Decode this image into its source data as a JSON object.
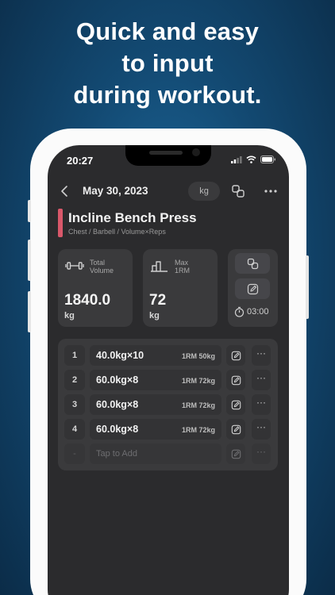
{
  "headline": [
    "Quick and easy",
    "to input",
    "during workout."
  ],
  "status": {
    "time": "20:27"
  },
  "nav": {
    "date": "May 30, 2023",
    "unit": "kg"
  },
  "exercise": {
    "title": "Incline Bench Press",
    "subtitle": "Chest / Barbell / Volume×Reps",
    "accent": "#d9586a"
  },
  "cards": {
    "volume": {
      "label_line1": "Total",
      "label_line2": "Volume",
      "value": "1840.0",
      "unit": "kg"
    },
    "max": {
      "label_line1": "Max",
      "label_line2": "1RM",
      "value": "72",
      "unit": "kg"
    },
    "timer": {
      "value": "03:00"
    }
  },
  "sets": [
    {
      "num": "1",
      "weight_reps": "40.0kg×10",
      "one_rm": "1RM 50kg"
    },
    {
      "num": "2",
      "weight_reps": "60.0kg×8",
      "one_rm": "1RM 72kg"
    },
    {
      "num": "3",
      "weight_reps": "60.0kg×8",
      "one_rm": "1RM 72kg"
    },
    {
      "num": "4",
      "weight_reps": "60.0kg×8",
      "one_rm": "1RM 72kg"
    }
  ],
  "add_row": {
    "num": "-",
    "placeholder": "Tap to Add"
  },
  "icons": {
    "back": "chevron-left-icon",
    "swap": "swap-icon",
    "more": "more-icon",
    "dumbbell": "dumbbell-icon",
    "chart": "bar-chart-icon",
    "copy": "copy-icon",
    "edit": "edit-icon",
    "timer": "stopwatch-icon"
  }
}
